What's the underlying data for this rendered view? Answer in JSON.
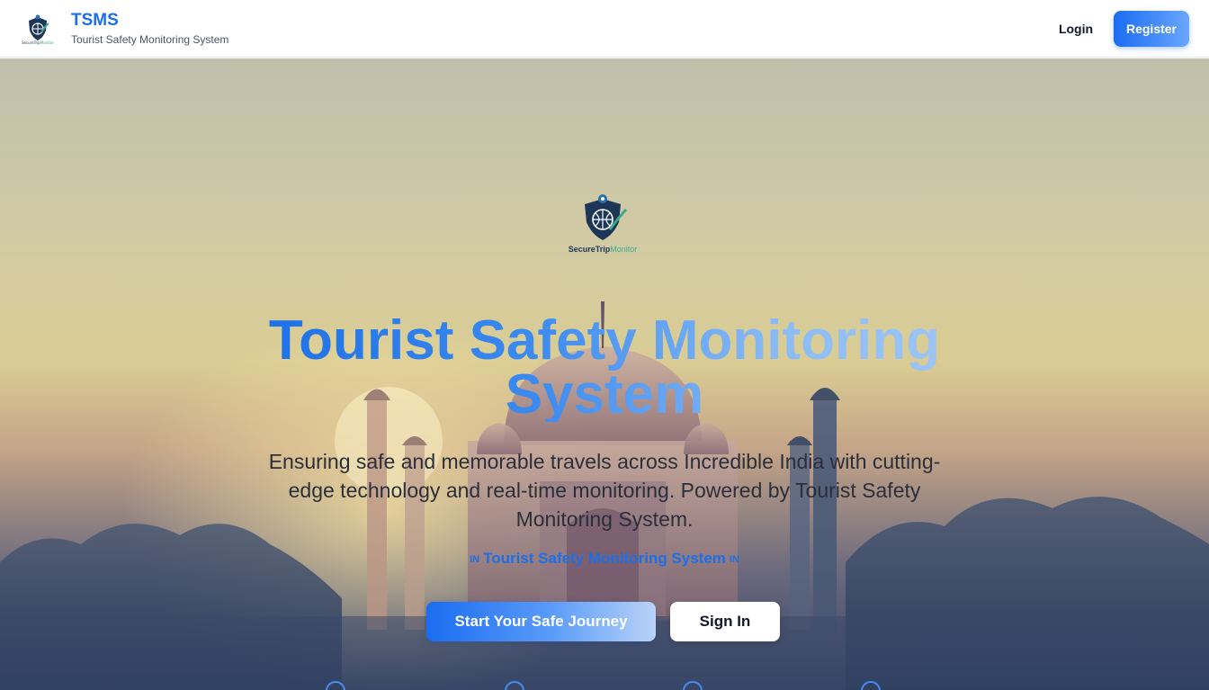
{
  "header": {
    "brand_name": "TSMS",
    "brand_subtitle": "Tourist Safety Monitoring System",
    "login_label": "Login",
    "register_label": "Register"
  },
  "hero": {
    "logo_name": "SecureTrip",
    "logo_name_accent": "Monitor",
    "title": "Tourist Safety Monitoring System",
    "description": "Ensuring safe and memorable travels across Incredible India with cutting-edge technology and real-time monitoring. Powered by Tourist Safety Monitoring System.",
    "tagline_flag_left": "IN",
    "tagline": "Tourist Safety Monitoring System",
    "tagline_flag_right": "IN",
    "primary_cta": "Start Your Safe Journey",
    "secondary_cta": "Sign In"
  },
  "icons": {
    "brand_logo": "shield-globe-logo-icon",
    "hero_logo": "shield-globe-logo-icon",
    "features": [
      "feature-icon",
      "feature-icon",
      "feature-icon",
      "feature-icon"
    ]
  },
  "colors": {
    "brand_blue": "#1c6fe6",
    "title_gradient_end": "#9fc6f5",
    "logo_accent": "#3aa98a"
  }
}
